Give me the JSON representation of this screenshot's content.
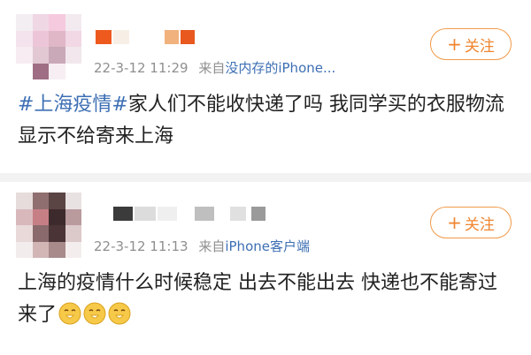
{
  "posts": [
    {
      "date": "22-3-12 11:29",
      "source_prefix": "来自",
      "source": "没内存的iPhone...",
      "follow_label": "关注",
      "follow_icon": "plus-icon",
      "hashtag": "#上海疫情#",
      "text": "家人们不能收快递了吗 我同学买的衣服物流显示不给寄来上海"
    },
    {
      "date": "22-3-12 11:13",
      "source_prefix": "来自",
      "source": "iPhone客户端",
      "follow_label": "关注",
      "follow_icon": "plus-icon",
      "text": "上海的疫情什么时候稳定 出去不能出去 快递也不能寄过来了",
      "emojis": [
        "praying-face-emoji",
        "praying-face-emoji",
        "praying-face-emoji"
      ]
    }
  ],
  "colors": {
    "link": "#3d6fb4",
    "accent": "#f08530",
    "meta": "#8f8f8f",
    "emoji": "#f7c948"
  }
}
